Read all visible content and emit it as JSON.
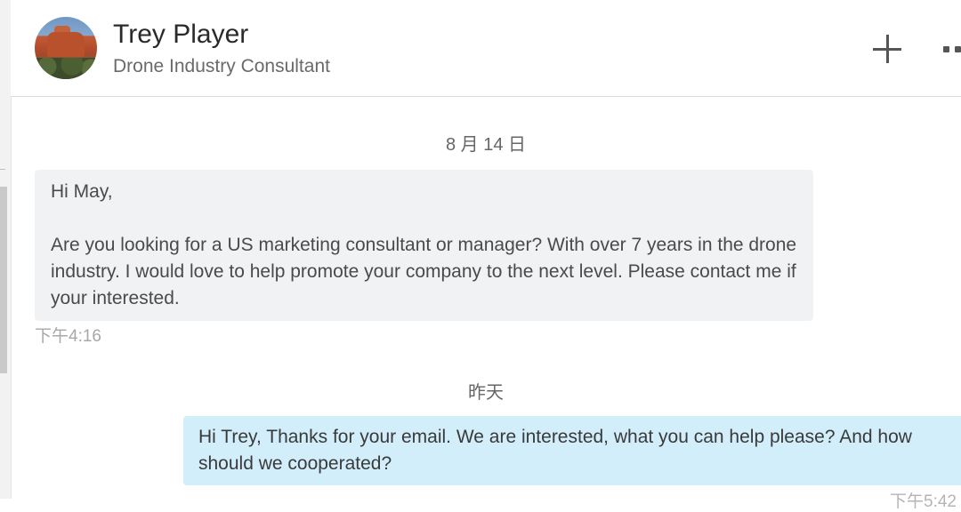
{
  "contact": {
    "name": "Trey Player",
    "title": "Drone Industry Consultant",
    "avatar_icon": "desert-rock-avatar"
  },
  "toolbar": {
    "add_icon": "plus-icon",
    "more_icon": "more-options-icon"
  },
  "conversation": {
    "separators": [
      "8 月 14 日",
      "昨天"
    ],
    "incoming": {
      "greeting": "Hi May,",
      "body": "Are you looking for a US marketing consultant or manager? With over 7 years in the drone industry. I would love to help promote your company to the next level. Please contact me if your interested.",
      "time": "下午4:16"
    },
    "outgoing": {
      "body": "Hi Trey, Thanks for your email. We are interested, what you can help please? And how should we cooperated?",
      "time": "下午5:42"
    }
  },
  "colors": {
    "incoming_bubble": "#f1f2f4",
    "outgoing_bubble": "#d2eefb"
  }
}
